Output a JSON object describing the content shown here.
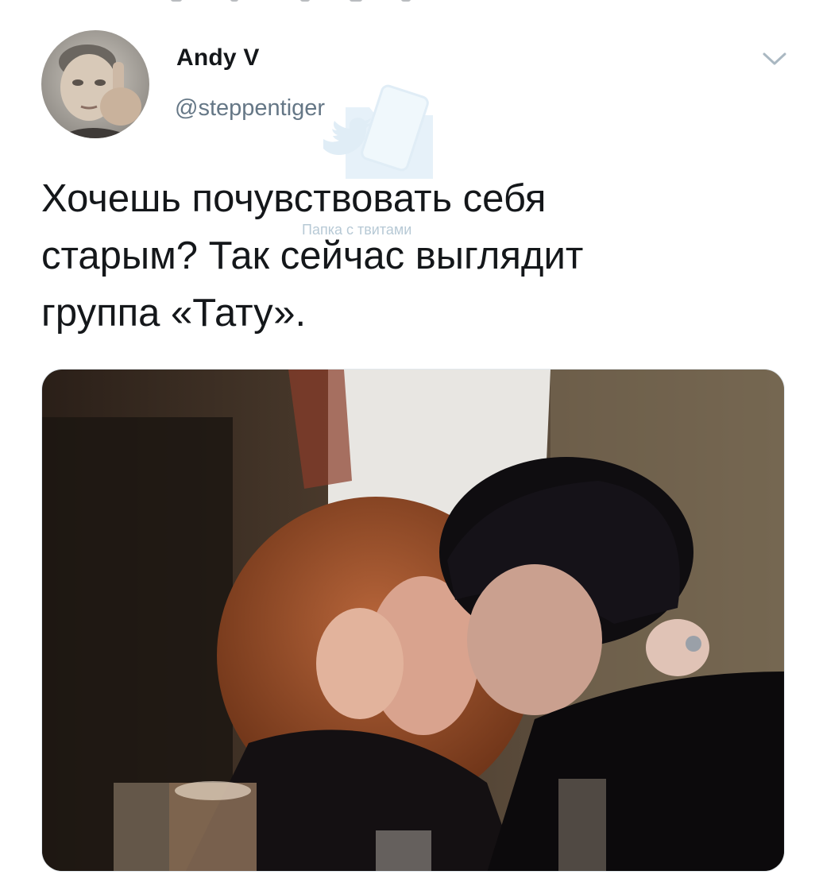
{
  "tweet": {
    "author": {
      "display_name": "Andy V",
      "handle": "@steppentiger",
      "avatar_icon": "avatar-photo-icon"
    },
    "menu_icon": "chevron-down-icon",
    "text_lines": [
      "Хочешь почувствовать себя",
      "старым? Так сейчас выглядит",
      "группа «Тату»."
    ]
  },
  "watermark": {
    "text": "Папка с твитами",
    "icon": "twitter-folder-icon"
  },
  "colors": {
    "text_primary": "#14171a",
    "text_secondary": "#657786",
    "chevron": "#aab8c2",
    "background": "#ffffff"
  }
}
